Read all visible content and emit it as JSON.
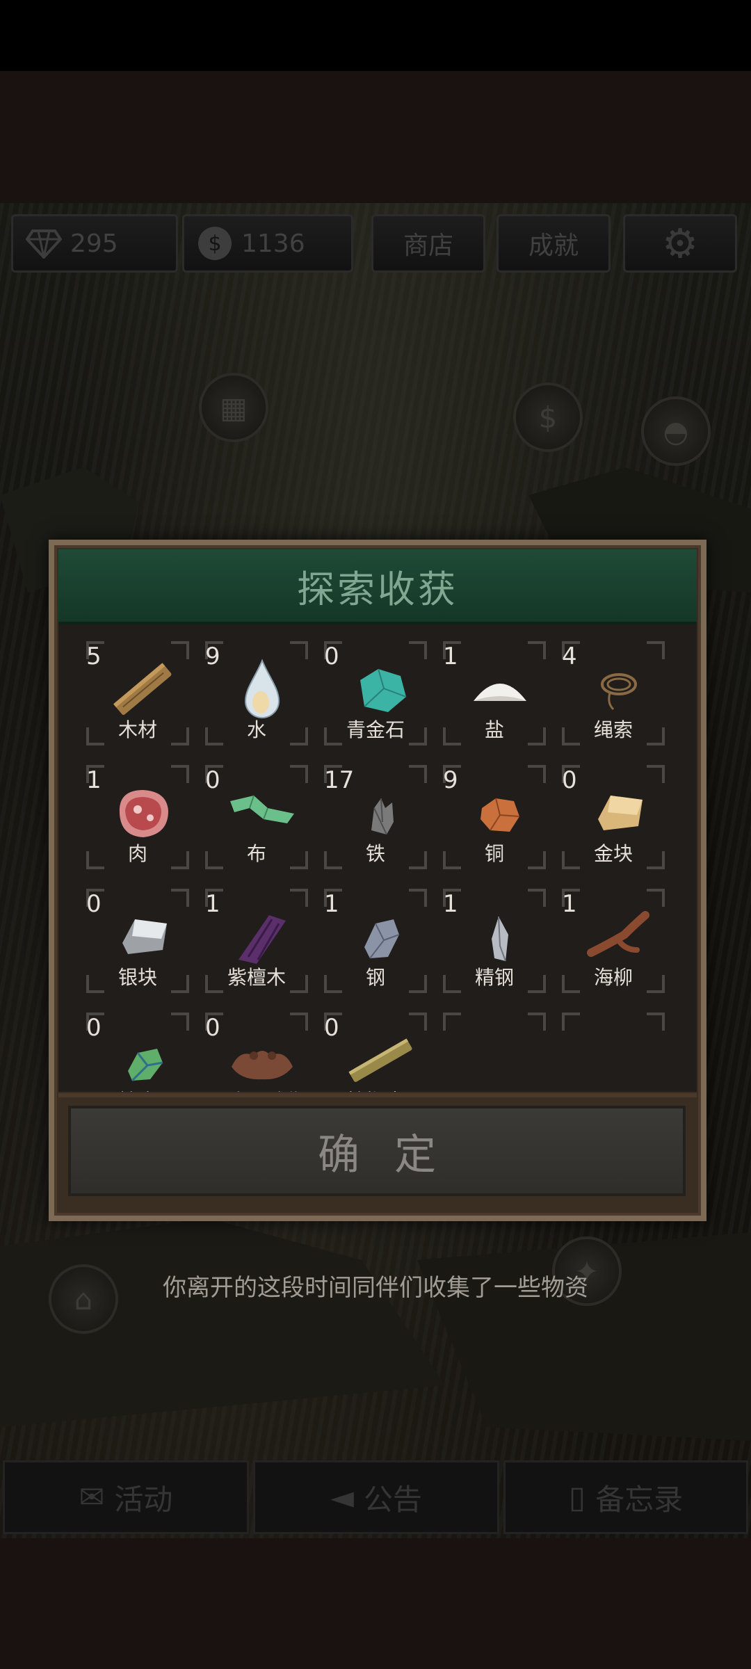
{
  "top_bar": {
    "diamonds": "295",
    "coins": "1136",
    "shop_label": "商店",
    "achievements_label": "成就"
  },
  "dialog": {
    "title": "探索收获",
    "items": [
      {
        "count": "5",
        "name": "木材",
        "icon": "wood-plank-icon"
      },
      {
        "count": "9",
        "name": "水",
        "icon": "water-drop-icon"
      },
      {
        "count": "0",
        "name": "青金石",
        "icon": "lapis-stone-icon"
      },
      {
        "count": "1",
        "name": "盐",
        "icon": "salt-pile-icon"
      },
      {
        "count": "4",
        "name": "绳索",
        "icon": "rope-icon"
      },
      {
        "count": "1",
        "name": "肉",
        "icon": "meat-icon"
      },
      {
        "count": "0",
        "name": "布",
        "icon": "cloth-icon"
      },
      {
        "count": "17",
        "name": "铁",
        "icon": "iron-ore-icon"
      },
      {
        "count": "9",
        "name": "铜",
        "icon": "copper-ore-icon"
      },
      {
        "count": "0",
        "name": "金块",
        "icon": "gold-ingot-icon"
      },
      {
        "count": "0",
        "name": "银块",
        "icon": "silver-ingot-icon"
      },
      {
        "count": "1",
        "name": "紫檀木",
        "icon": "rosewood-icon"
      },
      {
        "count": "1",
        "name": "钢",
        "icon": "steel-icon"
      },
      {
        "count": "1",
        "name": "精钢",
        "icon": "refined-steel-icon"
      },
      {
        "count": "1",
        "name": "海柳",
        "icon": "sea-willow-icon"
      },
      {
        "count": "0",
        "name": "精金",
        "icon": "fine-gold-gem-icon"
      },
      {
        "count": "0",
        "name": "双头石雕像",
        "icon": "two-headed-statue-icon"
      },
      {
        "count": "0",
        "name": "桄榔木",
        "icon": "palm-wood-icon"
      }
    ],
    "confirm_label": "确定"
  },
  "message": "你离开的这段时间同伴们收集了一些物资",
  "bottom_nav": {
    "events_label": "活动",
    "notice_label": "公告",
    "memo_label": "备忘录"
  }
}
